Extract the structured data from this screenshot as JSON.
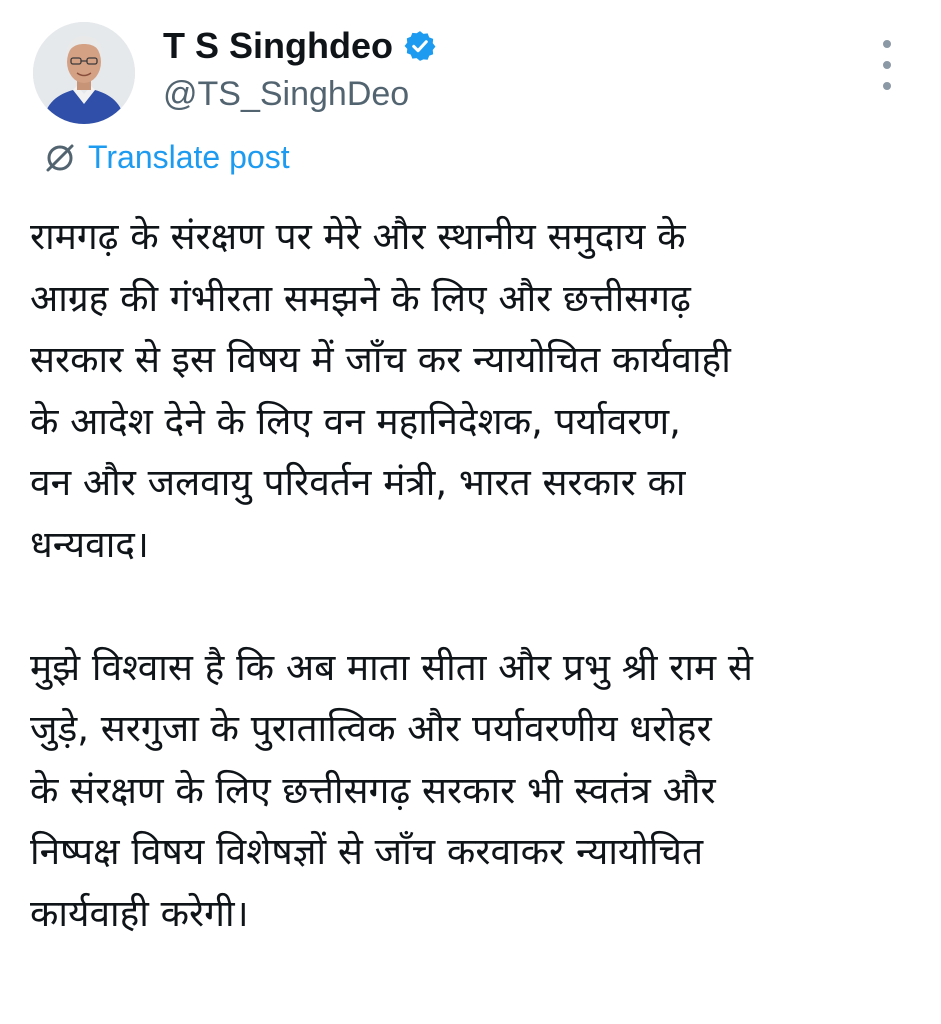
{
  "author": {
    "display_name": "T S Singhdeo",
    "handle": "@TS_SinghDeo",
    "verified": true,
    "verified_color": "#1d9bf0"
  },
  "actions": {
    "translate_label": "Translate post",
    "more_icon": "more-vertical-icon"
  },
  "colors": {
    "text": "#0f1419",
    "secondary": "#536471",
    "accent": "#1d9bf0"
  },
  "tweet": {
    "paragraphs": [
      {
        "lines": [
          "रामगढ़ के संरक्षण पर मेरे और स्थानीय समुदाय के",
          "आग्रह की गंभीरता समझने के लिए और छत्तीसगढ़",
          "सरकार से इस विषय में जाँच कर न्यायोचित कार्यवाही",
          "के आदेश देने के लिए वन महानिदेशक, पर्यावरण,",
          "वन और जलवायु परिवर्तन मंत्री, भारत सरकार का",
          "धन्यवाद।"
        ]
      },
      {
        "lines": [
          "मुझे विश्वास है कि अब माता सीता और प्रभु श्री राम से",
          "जुड़े, सरगुजा के पुरातात्विक और पर्यावरणीय धरोहर",
          "के संरक्षण के लिए छत्तीसगढ़ सरकार भी स्वतंत्र और",
          "निष्पक्ष विषय विशेषज्ञों से जाँच करवाकर न्यायोचित",
          "कार्यवाही करेगी।"
        ]
      }
    ]
  }
}
